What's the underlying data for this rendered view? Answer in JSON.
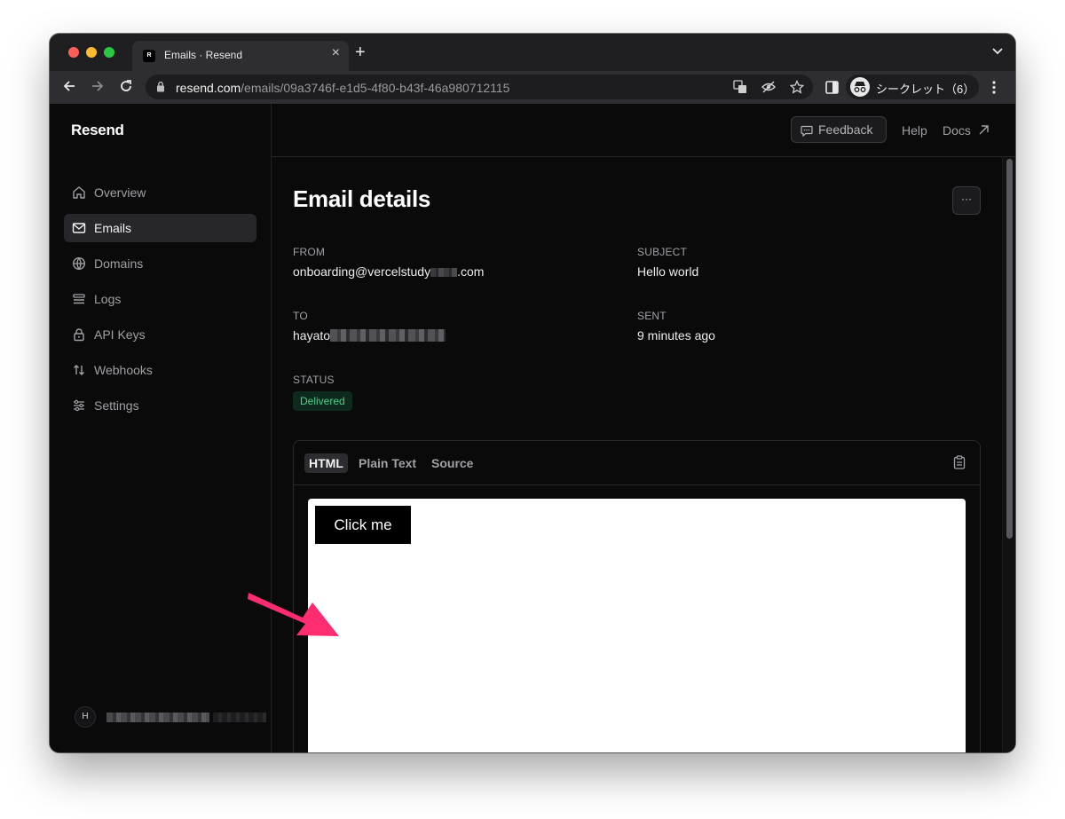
{
  "browser": {
    "tab_title": "Emails · Resend",
    "favicon_letter": "R",
    "url_host": "resend.com",
    "url_path": "/emails/09a3746f-e1d5-4f80-b43f-46a980712115",
    "profile_label": "シークレット（6）"
  },
  "app": {
    "logo": "Resend",
    "nav": [
      {
        "label": "Overview",
        "icon": "home-icon"
      },
      {
        "label": "Emails",
        "icon": "mail-icon",
        "active": true
      },
      {
        "label": "Domains",
        "icon": "globe-icon"
      },
      {
        "label": "Logs",
        "icon": "logs-icon"
      },
      {
        "label": "API Keys",
        "icon": "lock-icon"
      },
      {
        "label": "Webhooks",
        "icon": "arrows-updown-icon"
      },
      {
        "label": "Settings",
        "icon": "sliders-icon"
      }
    ],
    "account_initial": "H",
    "header": {
      "feedback": "Feedback",
      "help": "Help",
      "docs": "Docs"
    }
  },
  "email": {
    "page_title": "Email details",
    "more_button": "···",
    "from_label": "FROM",
    "from_value_prefix": "onboarding@vercelstudy",
    "from_value_suffix": ".com",
    "subject_label": "SUBJECT",
    "subject_value": "Hello world",
    "to_label": "TO",
    "to_value_prefix": "hayato",
    "sent_label": "SENT",
    "sent_value": "9 minutes ago",
    "status_label": "STATUS",
    "status_value": "Delivered",
    "status_color": "#4cd08d"
  },
  "preview": {
    "tabs": [
      "HTML",
      "Plain Text",
      "Source"
    ],
    "active_tab": "HTML",
    "button_label": "Click me"
  },
  "annotation": {
    "arrow_color": "#ff2d6f"
  }
}
